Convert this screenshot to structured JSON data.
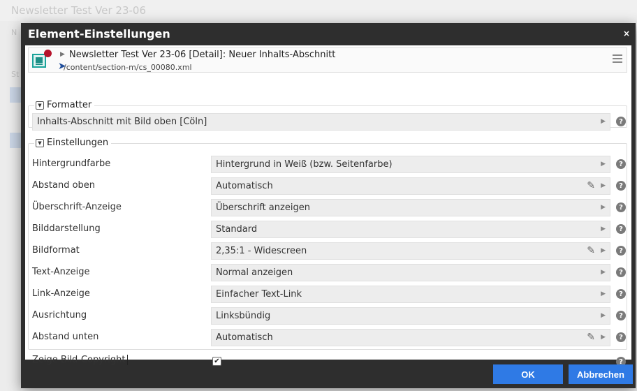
{
  "background": {
    "title": "Newsletter Test Ver 23-06",
    "side_letters": [
      "N",
      "St"
    ]
  },
  "dialog": {
    "title": "Element-Einstellungen",
    "close_label": "×",
    "ok_label": "OK",
    "cancel_label": "Abbrechen"
  },
  "element": {
    "title": "Newsletter Test Ver 23-06 [Detail]: Neuer Inhalts-Abschnitt",
    "path": "/content/section-m/cs_00080.xml",
    "icon": "page-element-icon"
  },
  "formatter": {
    "legend": "Formatter",
    "value": "Inhalts-Abschnitt mit Bild oben [Cöln]"
  },
  "settings": {
    "legend": "Einstellungen",
    "rows": [
      {
        "label": "Hintergrundfarbe",
        "value": "Hintergrund in Weiß (bzw. Seitenfarbe)",
        "editable": false
      },
      {
        "label": "Abstand oben",
        "value": "Automatisch",
        "editable": true
      },
      {
        "label": "Überschrift-Anzeige",
        "value": "Überschrift anzeigen",
        "editable": false
      },
      {
        "label": "Bilddarstellung",
        "value": "Standard",
        "editable": false
      },
      {
        "label": "Bildformat",
        "value": "2,35:1 - Widescreen",
        "editable": true
      },
      {
        "label": "Text-Anzeige",
        "value": "Normal anzeigen",
        "editable": false
      },
      {
        "label": "Link-Anzeige",
        "value": "Einfacher Text-Link",
        "editable": false
      },
      {
        "label": "Ausrichtung",
        "value": "Linksbündig",
        "editable": false
      },
      {
        "label": "Abstand unten",
        "value": "Automatisch",
        "editable": true
      }
    ],
    "copyright": {
      "label": "Zeige Bild-Copyright",
      "checked": true
    }
  },
  "colors": {
    "dialog_bg": "#2e2e2e",
    "button": "#2f7ae5",
    "element_icon": "#1aa39a",
    "status_dot": "#b6132b"
  }
}
